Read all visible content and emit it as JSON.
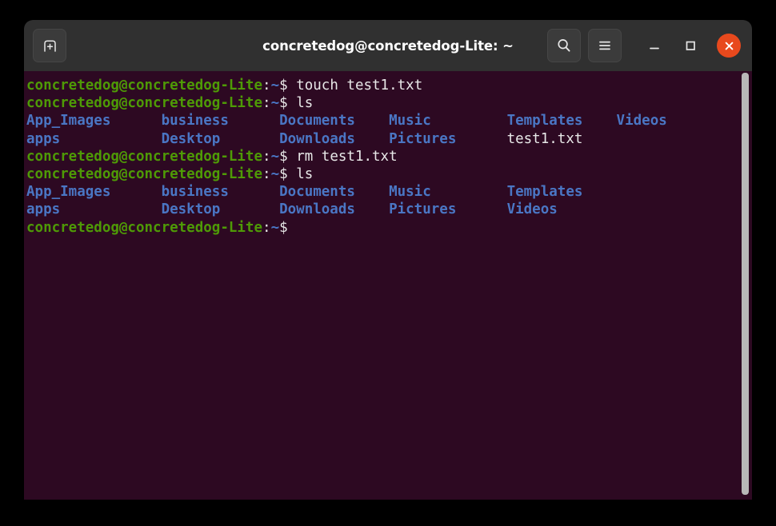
{
  "window": {
    "title": "concretedog@concretedog-Lite: ~",
    "new_tab_label": "New Tab",
    "search_label": "Search",
    "menu_label": "Menu",
    "minimize_label": "Minimize",
    "maximize_label": "Maximize",
    "close_label": "Close"
  },
  "colors": {
    "titlebar_bg": "#303030",
    "terminal_bg": "#2d0922",
    "prompt_green": "#4e9a06",
    "dir_blue": "#4a76c4",
    "text_white": "#e8e8e8",
    "close_orange": "#e8491d",
    "scrollbar": "#b8b8b8"
  },
  "terminal": {
    "prompt_user_host": "concretedog@concretedog-Lite",
    "prompt_colon": ":",
    "prompt_path": "~",
    "prompt_sigil": "$",
    "lines": [
      {
        "type": "prompt",
        "command": " touch test1.txt"
      },
      {
        "type": "prompt",
        "command": " ls"
      },
      {
        "type": "output",
        "cells": [
          {
            "text": "App_Images",
            "color": "blue",
            "pad": 16
          },
          {
            "text": "business",
            "color": "blue",
            "pad": 14
          },
          {
            "text": "Documents",
            "color": "blue",
            "pad": 13
          },
          {
            "text": "Music",
            "color": "blue",
            "pad": 14
          },
          {
            "text": "Templates",
            "color": "blue",
            "pad": 13
          },
          {
            "text": "Videos",
            "color": "blue",
            "pad": 0
          }
        ]
      },
      {
        "type": "output",
        "cells": [
          {
            "text": "apps",
            "color": "blue",
            "pad": 16
          },
          {
            "text": "Desktop",
            "color": "blue",
            "pad": 14
          },
          {
            "text": "Downloads",
            "color": "blue",
            "pad": 13
          },
          {
            "text": "Pictures",
            "color": "blue",
            "pad": 14
          },
          {
            "text": "test1.txt",
            "color": "white",
            "pad": 0
          }
        ]
      },
      {
        "type": "prompt",
        "command": " rm test1.txt"
      },
      {
        "type": "prompt",
        "command": " ls"
      },
      {
        "type": "output",
        "cells": [
          {
            "text": "App_Images",
            "color": "blue",
            "pad": 16
          },
          {
            "text": "business",
            "color": "blue",
            "pad": 14
          },
          {
            "text": "Documents",
            "color": "blue",
            "pad": 13
          },
          {
            "text": "Music",
            "color": "blue",
            "pad": 14
          },
          {
            "text": "Templates",
            "color": "blue",
            "pad": 0
          }
        ]
      },
      {
        "type": "output",
        "cells": [
          {
            "text": "apps",
            "color": "blue",
            "pad": 16
          },
          {
            "text": "Desktop",
            "color": "blue",
            "pad": 14
          },
          {
            "text": "Downloads",
            "color": "blue",
            "pad": 13
          },
          {
            "text": "Pictures",
            "color": "blue",
            "pad": 14
          },
          {
            "text": "Videos",
            "color": "blue",
            "pad": 0
          }
        ]
      },
      {
        "type": "prompt",
        "command": ""
      }
    ]
  }
}
